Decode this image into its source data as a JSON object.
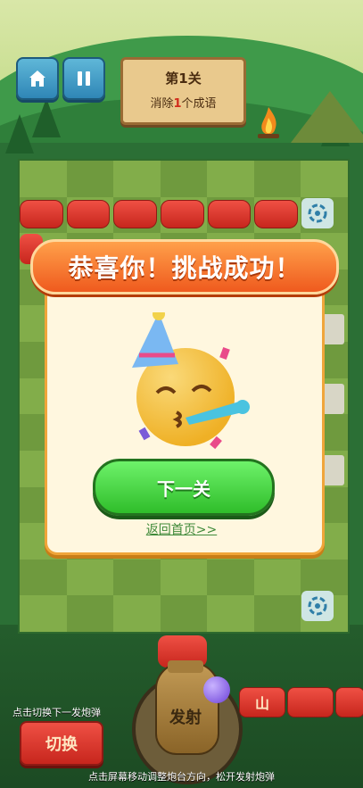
{
  "header": {
    "home_icon": "home-icon",
    "pause_icon": "pause-icon",
    "level_title": "第1关",
    "level_sub_prefix": "消除",
    "level_sub_count": "1",
    "level_sub_suffix": "个成语"
  },
  "modal": {
    "title": "恭喜你！挑战成功！",
    "emoji": "party-face-icon",
    "next_button": "下一关",
    "back_link": "返回首页>>"
  },
  "bottom": {
    "switch_hint": "点击切换下一发炮弹",
    "switch_button": "切换",
    "fire_button": "发射",
    "queue_labels": [
      "山",
      "",
      ""
    ],
    "hint": "点击屏幕移动调整炮台方向，松开发射炮弹"
  },
  "colors": {
    "accent_red": "#d12c1c",
    "modal_border": "#f0a53a",
    "success_green": "#2fbd2a"
  }
}
